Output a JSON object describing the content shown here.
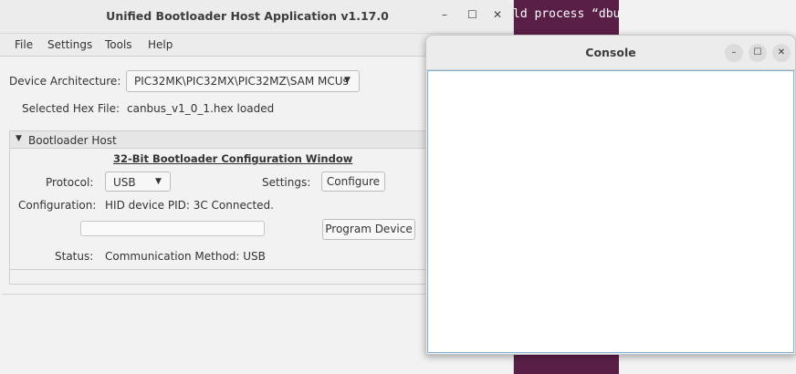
{
  "terminal": {
    "text": "ld process “dbu"
  },
  "window": {
    "title": "Unified Bootloader Host Application v1.17.0"
  },
  "menu": [
    "File",
    "Settings",
    "Tools",
    "Help"
  ],
  "device": {
    "label": "Device Architecture:",
    "value": "PIC32MK\\PIC32MX\\PIC32MZ\\SAM MCUs"
  },
  "hex": {
    "label": "Selected Hex File:",
    "value": "canbus_v1_0_1.hex loaded"
  },
  "panel": {
    "header": "Bootloader Host",
    "title": "32-Bit Bootloader Configuration Window",
    "protocol_label": "Protocol:",
    "protocol_value": "USB",
    "settings_label": "Settings:",
    "configure_label": "Configure",
    "configuration_label": "Configuration:",
    "configuration_value": "HID device PID: 3C Connected.",
    "program_label": "Program Device",
    "progress": 0,
    "status_label": "Status:",
    "status_value": "Communication Method: USB"
  },
  "console": {
    "title": "Console"
  }
}
